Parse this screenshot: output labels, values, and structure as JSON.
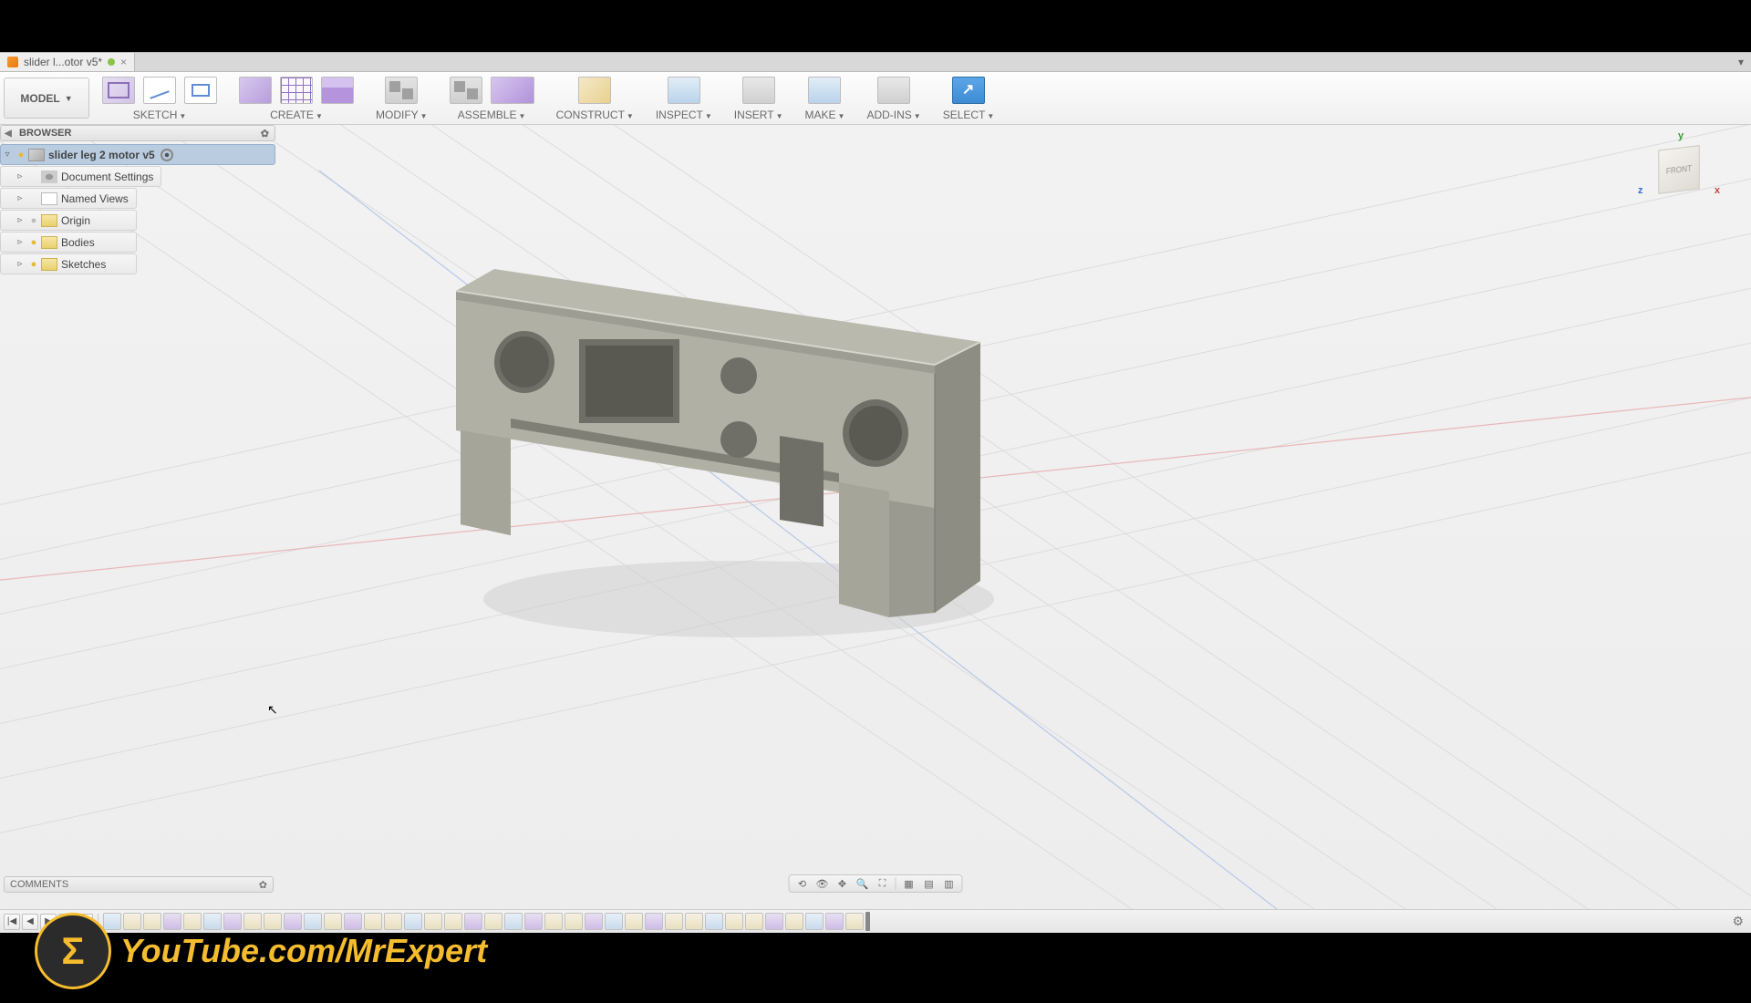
{
  "tab": {
    "title": "slider l...otor v5*"
  },
  "workspace": "MODEL",
  "toolbar": [
    {
      "label": "SKETCH",
      "icons": [
        "sketch",
        "line",
        "rect"
      ]
    },
    {
      "label": "CREATE",
      "icons": [
        "box3d",
        "boxgrid",
        "extrude"
      ]
    },
    {
      "label": "MODIFY",
      "icons": [
        "pattern"
      ]
    },
    {
      "label": "ASSEMBLE",
      "icons": [
        "pattern",
        "assembly"
      ]
    },
    {
      "label": "CONSTRUCT",
      "icons": [
        "construct"
      ]
    },
    {
      "label": "INSPECT",
      "icons": [
        "inspect"
      ]
    },
    {
      "label": "INSERT",
      "icons": [
        "insert"
      ]
    },
    {
      "label": "MAKE",
      "icons": [
        "make"
      ]
    },
    {
      "label": "ADD-INS",
      "icons": [
        "addins"
      ]
    },
    {
      "label": "SELECT",
      "icons": [
        "select"
      ]
    }
  ],
  "browser": {
    "title": "BROWSER",
    "root": "slider leg 2 motor v5",
    "items": [
      {
        "label": "Document Settings",
        "icon": "ni-gear",
        "bulb": false
      },
      {
        "label": "Named Views",
        "icon": "ni-doc",
        "bulb": false
      },
      {
        "label": "Origin",
        "icon": "ni-folder",
        "bulb": true,
        "off": true
      },
      {
        "label": "Bodies",
        "icon": "ni-folder",
        "bulb": true
      },
      {
        "label": "Sketches",
        "icon": "ni-folder",
        "bulb": true
      }
    ]
  },
  "comments": "COMMENTS",
  "viewcube": {
    "face": "FRONT",
    "y": "y",
    "x": "x",
    "z": "z"
  },
  "watermark": {
    "logo": "Σ",
    "text": "YouTube.com/MrExpert"
  },
  "timeline_features": 38
}
